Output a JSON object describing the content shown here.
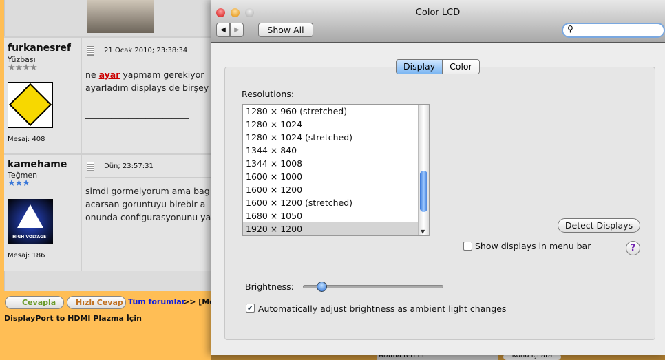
{
  "forum": {
    "posts": [
      {
        "username": "furkanesref",
        "rank": "Yüzbaşı",
        "stars": "★★★★",
        "star_color": "#888888",
        "date": "21 Ocak 2010; 23:38:34",
        "body_pre": "ne ",
        "body_link": "ayar",
        "body_post": " yapmam gerekiyor",
        "body_line2": "ayarladım displays de birşey",
        "signature_line": "________________________",
        "message_count": "Mesaj: 408",
        "avatar": "under-construction-sign"
      },
      {
        "username": "kamehame",
        "rank": "Teğmen",
        "stars": "★★★",
        "star_color": "#3b78d8",
        "date": "Dün; 23:57:31",
        "body_line1": "simdi gormeiyorum ama bag",
        "body_line2": "acarsan goruntuyu birebir a",
        "body_line3": "onunda configurasyonunu ya",
        "message_count": "Mesaj: 186",
        "avatar": "high-voltage-sign",
        "avatar_text": "HIGH VOLTAGE!"
      }
    ],
    "reply_button": "Cevapla",
    "quick_reply_button": "Hızlı Cevap",
    "all_forums_link": "Tüm forumlar",
    "breadcrumb_rest": ">> [Mo",
    "topic_title": "DisplayPort to HDMI Plazma İçin",
    "search_input": "Arama terimi",
    "search_topic_button": "Konu içi ara"
  },
  "window": {
    "title": "Color LCD",
    "show_all": "Show All",
    "search_placeholder": "",
    "tabs": [
      {
        "label": "Display",
        "selected": true
      },
      {
        "label": "Color",
        "selected": false
      }
    ],
    "resolutions_label": "Resolutions:",
    "resolutions": [
      "1280 × 960 (stretched)",
      "1280 × 1024",
      "1280 × 1024 (stretched)",
      "1344 × 840",
      "1344 × 1008",
      "1600 × 1000",
      "1600 × 1200",
      "1600 × 1200 (stretched)",
      "1680 × 1050",
      "1920 × 1200"
    ],
    "selected_resolution": "1920 × 1200",
    "detect_displays": "Detect Displays",
    "show_in_menu_bar": "Show displays in menu bar",
    "show_in_menu_bar_checked": false,
    "brightness_label": "Brightness:",
    "brightness_percent": 10,
    "auto_brightness": "Automatically adjust brightness as ambient light changes",
    "auto_brightness_checked": true,
    "help": "?"
  }
}
